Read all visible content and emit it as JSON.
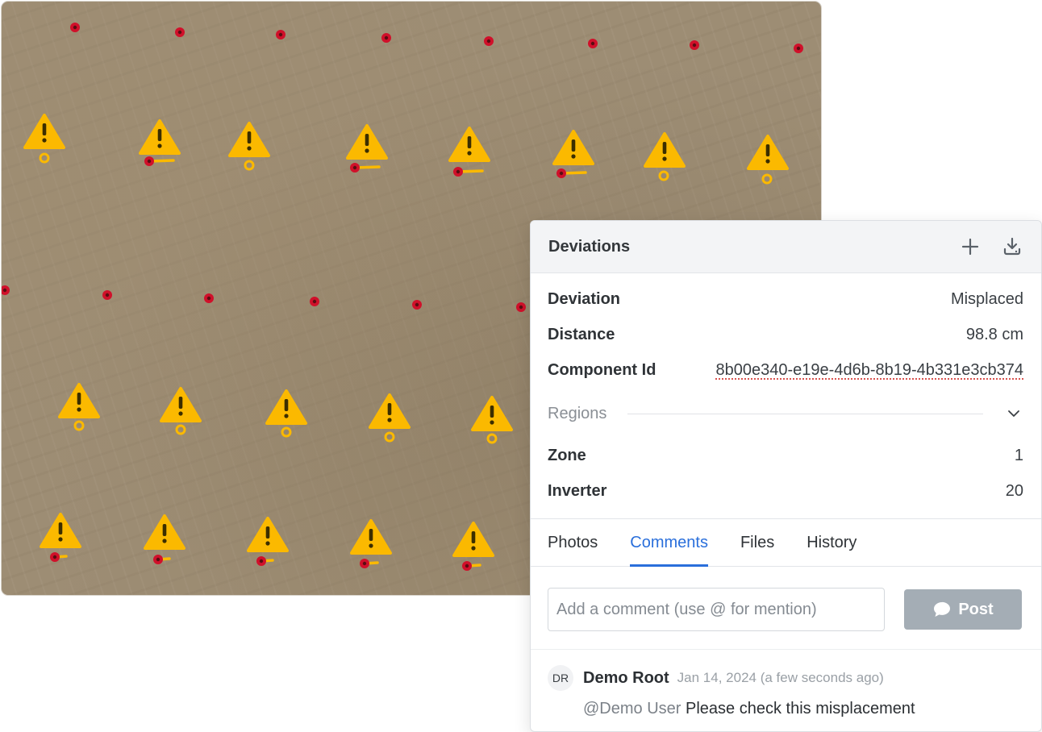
{
  "panel": {
    "title": "Deviations",
    "icons": {
      "add": "plus-icon",
      "download": "download-icon"
    },
    "details": [
      {
        "label": "Deviation",
        "value": "Misplaced"
      },
      {
        "label": "Distance",
        "value": "98.8 cm"
      },
      {
        "label": "Component Id",
        "value": "8b00e340-e19e-4d6b-8b19-4b331e3cb374"
      }
    ],
    "regions_label": "Regions",
    "regions": [
      {
        "label": "Zone",
        "value": "1"
      },
      {
        "label": "Inverter",
        "value": "20"
      }
    ]
  },
  "tabs": [
    {
      "label": "Photos",
      "active": false
    },
    {
      "label": "Comments",
      "active": true
    },
    {
      "label": "Files",
      "active": false
    },
    {
      "label": "History",
      "active": false
    }
  ],
  "composer": {
    "placeholder": "Add a comment (use @ for mention)",
    "post_label": "Post"
  },
  "comment": {
    "initials": "DR",
    "author": "Demo Root",
    "time": "Jan 14, 2024 (a few seconds ago)",
    "mention": "@Demo User",
    "text": "Please check this misplacement"
  },
  "colors": {
    "accent": "#2a6fdb",
    "warning": "#fbb900",
    "marker_red": "#d0102a",
    "post_button": "#a4adb5"
  }
}
